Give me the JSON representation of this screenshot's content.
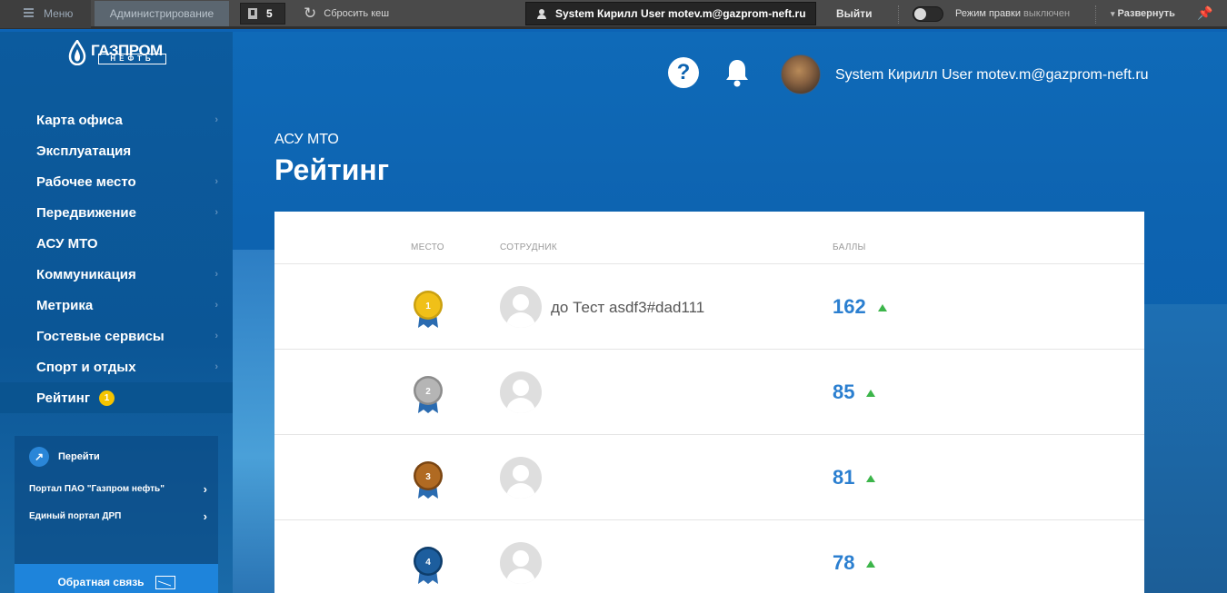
{
  "topbar": {
    "menu_label": "Меню",
    "admin_label": "Администрирование",
    "badge_count": "5",
    "reset_cache_label": "Сбросить кеш",
    "user_label": "System Кирилл User motev.m@gazprom-neft.ru",
    "logout_label": "Выйти",
    "edit_mode_label": "Режим правки",
    "edit_mode_state": "выключен",
    "expand_label": "Развернуть"
  },
  "logo": {
    "line1": "ГАЗПРОМ",
    "line2": "НЕФТЬ"
  },
  "sidebar": {
    "items": [
      {
        "label": "Карта офиса",
        "chevron": true
      },
      {
        "label": "Эксплуатация",
        "chevron": false
      },
      {
        "label": "Рабочее место",
        "chevron": true
      },
      {
        "label": "Передвижение",
        "chevron": true
      },
      {
        "label": "АСУ МТО",
        "chevron": false
      },
      {
        "label": "Коммуникация",
        "chevron": true
      },
      {
        "label": "Метрика",
        "chevron": true
      },
      {
        "label": "Гостевые сервисы",
        "chevron": true
      },
      {
        "label": "Спорт и отдых",
        "chevron": true
      },
      {
        "label": "Рейтинг",
        "chevron": false,
        "badge": "1"
      }
    ],
    "active_index": 9,
    "goto": {
      "title": "Перейти",
      "links": [
        "Портал ПАО \"Газпром нефть\"",
        "Единый портал ДРП"
      ]
    },
    "feedback_label": "Обратная связь"
  },
  "header": {
    "help_glyph": "?",
    "user_name": "System Кирилл User motev.m@gazprom-neft.ru"
  },
  "page": {
    "breadcrumb": "АСУ МТО",
    "title": "Рейтинг"
  },
  "table": {
    "columns": {
      "place": "МЕСТО",
      "employee": "СОТРУДНИК",
      "score": "БАЛЛЫ"
    },
    "rows": [
      {
        "place": "1",
        "medal": "gold",
        "name": "до Тест asdf3#dad111",
        "score": "162",
        "trend": "up"
      },
      {
        "place": "2",
        "medal": "silver",
        "name": "",
        "score": "85",
        "trend": "up"
      },
      {
        "place": "3",
        "medal": "bronze",
        "name": "",
        "score": "81",
        "trend": "up"
      },
      {
        "place": "4",
        "medal": "blue",
        "name": "",
        "score": "78",
        "trend": "up"
      }
    ]
  },
  "colors": {
    "brand_blue": "#0d63b4",
    "score_blue": "#2b7fd0",
    "trend_green": "#3cb54a",
    "gold": "#f0c018",
    "silver": "#b5b5b5",
    "bronze": "#b06a22",
    "blue_medal": "#1d5e9e",
    "ribbon": "#2a6bb0"
  }
}
